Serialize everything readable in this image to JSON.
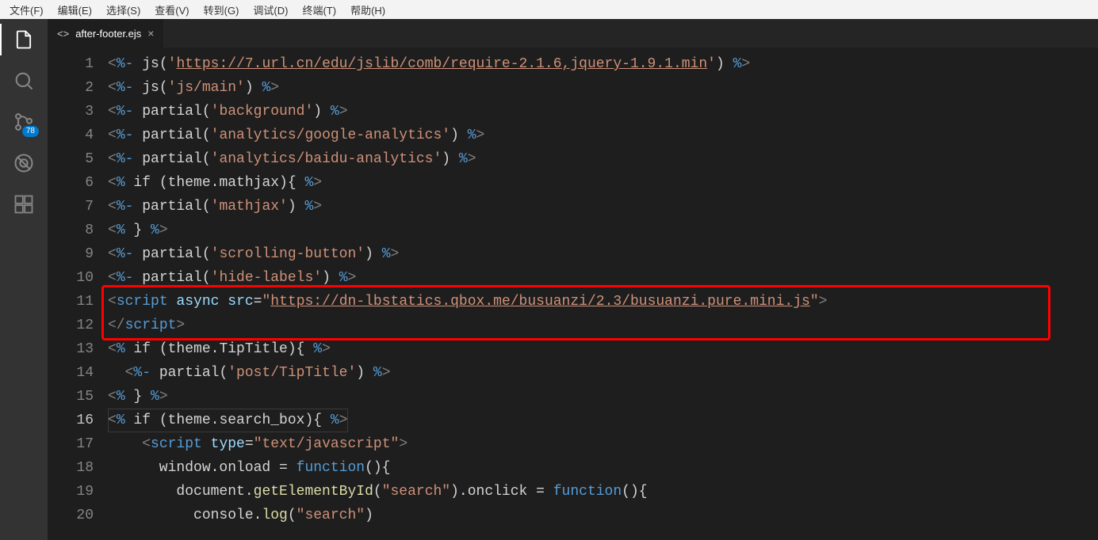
{
  "menu": {
    "file": "文件(F)",
    "edit": "编辑(E)",
    "selection": "选择(S)",
    "view": "查看(V)",
    "goto": "转到(G)",
    "debug": "调试(D)",
    "terminal": "终端(T)",
    "help": "帮助(H)"
  },
  "activity": {
    "scm_badge": "78"
  },
  "tab": {
    "filename": "after-footer.ejs",
    "close": "×"
  },
  "code": {
    "line_start": 1,
    "current_line": 16,
    "highlight_start": 11,
    "highlight_end": 12,
    "lines": [
      {
        "n": 1,
        "t": [
          [
            "s-tag",
            "<"
          ],
          [
            "s-kw",
            "%-"
          ],
          [
            "s-txt",
            " js("
          ],
          [
            "s-str",
            "'"
          ],
          [
            "s-url",
            "https://7.url.cn/edu/jslib/comb/require-2.1.6,jquery-1.9.1.min"
          ],
          [
            "s-str",
            "'"
          ],
          [
            "s-txt",
            ") "
          ],
          [
            "s-kw",
            "%"
          ],
          [
            "s-tag",
            ">"
          ]
        ]
      },
      {
        "n": 2,
        "t": [
          [
            "s-tag",
            "<"
          ],
          [
            "s-kw",
            "%-"
          ],
          [
            "s-txt",
            " js("
          ],
          [
            "s-str",
            "'js/main'"
          ],
          [
            "s-txt",
            ") "
          ],
          [
            "s-kw",
            "%"
          ],
          [
            "s-tag",
            ">"
          ]
        ]
      },
      {
        "n": 3,
        "t": [
          [
            "s-tag",
            "<"
          ],
          [
            "s-kw",
            "%-"
          ],
          [
            "s-txt",
            " partial("
          ],
          [
            "s-str",
            "'background'"
          ],
          [
            "s-txt",
            ") "
          ],
          [
            "s-kw",
            "%"
          ],
          [
            "s-tag",
            ">"
          ]
        ]
      },
      {
        "n": 4,
        "t": [
          [
            "s-tag",
            "<"
          ],
          [
            "s-kw",
            "%-"
          ],
          [
            "s-txt",
            " partial("
          ],
          [
            "s-str",
            "'analytics/google-analytics'"
          ],
          [
            "s-txt",
            ") "
          ],
          [
            "s-kw",
            "%"
          ],
          [
            "s-tag",
            ">"
          ]
        ]
      },
      {
        "n": 5,
        "t": [
          [
            "s-tag",
            "<"
          ],
          [
            "s-kw",
            "%-"
          ],
          [
            "s-txt",
            " partial("
          ],
          [
            "s-str",
            "'analytics/baidu-analytics'"
          ],
          [
            "s-txt",
            ") "
          ],
          [
            "s-kw",
            "%"
          ],
          [
            "s-tag",
            ">"
          ]
        ]
      },
      {
        "n": 6,
        "t": [
          [
            "s-tag",
            "<"
          ],
          [
            "s-kw",
            "%"
          ],
          [
            "s-txt",
            " if (theme.mathjax){ "
          ],
          [
            "s-kw",
            "%"
          ],
          [
            "s-tag",
            ">"
          ]
        ]
      },
      {
        "n": 7,
        "t": [
          [
            "s-tag",
            "<"
          ],
          [
            "s-kw",
            "%-"
          ],
          [
            "s-txt",
            " partial("
          ],
          [
            "s-str",
            "'mathjax'"
          ],
          [
            "s-txt",
            ") "
          ],
          [
            "s-kw",
            "%"
          ],
          [
            "s-tag",
            ">"
          ]
        ]
      },
      {
        "n": 8,
        "t": [
          [
            "s-tag",
            "<"
          ],
          [
            "s-kw",
            "%"
          ],
          [
            "s-txt",
            " } "
          ],
          [
            "s-kw",
            "%"
          ],
          [
            "s-tag",
            ">"
          ]
        ]
      },
      {
        "n": 9,
        "t": [
          [
            "s-tag",
            "<"
          ],
          [
            "s-kw",
            "%-"
          ],
          [
            "s-txt",
            " partial("
          ],
          [
            "s-str",
            "'scrolling-button'"
          ],
          [
            "s-txt",
            ") "
          ],
          [
            "s-kw",
            "%"
          ],
          [
            "s-tag",
            ">"
          ]
        ]
      },
      {
        "n": 10,
        "t": [
          [
            "s-tag",
            "<"
          ],
          [
            "s-kw",
            "%-"
          ],
          [
            "s-txt",
            " partial("
          ],
          [
            "s-str",
            "'hide-labels'"
          ],
          [
            "s-txt",
            ") "
          ],
          [
            "s-kw",
            "%"
          ],
          [
            "s-tag",
            ">"
          ]
        ]
      },
      {
        "n": 11,
        "t": [
          [
            "s-tag",
            "<"
          ],
          [
            "s-kw",
            "script"
          ],
          [
            "s-txt",
            " "
          ],
          [
            "s-attr",
            "async"
          ],
          [
            "s-txt",
            " "
          ],
          [
            "s-attr",
            "src"
          ],
          [
            "s-txt",
            "="
          ],
          [
            "s-str",
            "\""
          ],
          [
            "s-url",
            "https://dn-lbstatics.qbox.me/busuanzi/2.3/busuanzi.pure.mini.js"
          ],
          [
            "s-str",
            "\""
          ],
          [
            "s-tag",
            ">"
          ]
        ]
      },
      {
        "n": 12,
        "t": [
          [
            "s-tag",
            "</"
          ],
          [
            "s-kw",
            "script"
          ],
          [
            "s-tag",
            ">"
          ]
        ]
      },
      {
        "n": 13,
        "t": [
          [
            "s-tag",
            "<"
          ],
          [
            "s-kw",
            "%"
          ],
          [
            "s-txt",
            " if (theme.TipTitle){ "
          ],
          [
            "s-kw",
            "%"
          ],
          [
            "s-tag",
            ">"
          ]
        ]
      },
      {
        "n": 14,
        "t": [
          [
            "s-txt",
            "  "
          ],
          [
            "s-tag",
            "<"
          ],
          [
            "s-kw",
            "%-"
          ],
          [
            "s-txt",
            " partial("
          ],
          [
            "s-str",
            "'post/TipTitle'"
          ],
          [
            "s-txt",
            ") "
          ],
          [
            "s-kw",
            "%"
          ],
          [
            "s-tag",
            ">"
          ]
        ]
      },
      {
        "n": 15,
        "t": [
          [
            "s-tag",
            "<"
          ],
          [
            "s-kw",
            "%"
          ],
          [
            "s-txt",
            " } "
          ],
          [
            "s-kw",
            "%"
          ],
          [
            "s-tag",
            ">"
          ]
        ]
      },
      {
        "n": 16,
        "cur": true,
        "t": [
          [
            "s-tag",
            "<"
          ],
          [
            "s-kw",
            "%"
          ],
          [
            "s-txt",
            " if (theme.search_box){ "
          ],
          [
            "s-kw",
            "%"
          ],
          [
            "s-tag",
            ">"
          ]
        ]
      },
      {
        "n": 17,
        "t": [
          [
            "s-txt",
            "    "
          ],
          [
            "s-tag",
            "<"
          ],
          [
            "s-kw",
            "script"
          ],
          [
            "s-txt",
            " "
          ],
          [
            "s-attr",
            "type"
          ],
          [
            "s-txt",
            "="
          ],
          [
            "s-str",
            "\"text/javascript\""
          ],
          [
            "s-tag",
            ">"
          ]
        ]
      },
      {
        "n": 18,
        "t": [
          [
            "s-txt",
            "      window.onload = "
          ],
          [
            "s-kw",
            "function"
          ],
          [
            "s-txt",
            "(){"
          ]
        ]
      },
      {
        "n": 19,
        "t": [
          [
            "s-txt",
            "        document."
          ],
          [
            "s-fn",
            "getElementById"
          ],
          [
            "s-txt",
            "("
          ],
          [
            "s-str",
            "\"search\""
          ],
          [
            "s-txt",
            ").onclick = "
          ],
          [
            "s-kw",
            "function"
          ],
          [
            "s-txt",
            "(){"
          ]
        ]
      },
      {
        "n": 20,
        "t": [
          [
            "s-txt",
            "          console."
          ],
          [
            "s-fn",
            "log"
          ],
          [
            "s-txt",
            "("
          ],
          [
            "s-str",
            "\"search\""
          ],
          [
            "s-txt",
            ")"
          ]
        ]
      }
    ]
  }
}
